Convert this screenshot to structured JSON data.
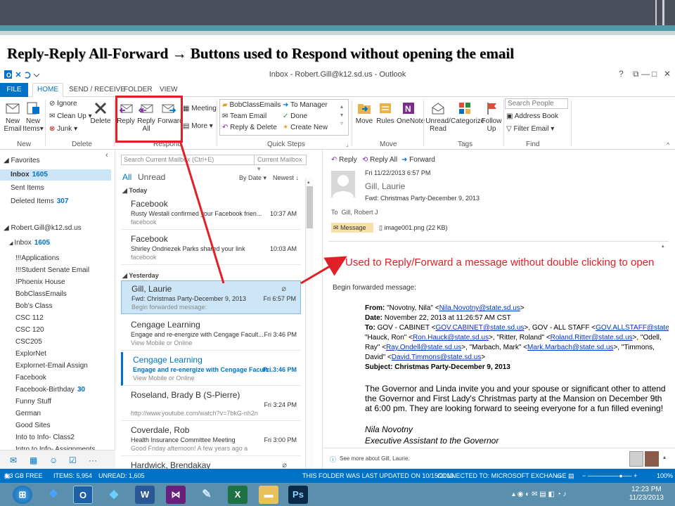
{
  "slide": {
    "title_part1": "Reply-Reply All-Forward",
    "title_arrow": "→",
    "title_part2": "Buttons used to Respond without opening the email"
  },
  "window": {
    "title": "Inbox - Robert.Gill@k12.sd.us - Outlook",
    "help_label": "?",
    "restore_label": "⧉",
    "minimize_label": "—",
    "maximize_label": "□",
    "close_label": "✕"
  },
  "tabs": [
    "FILE",
    "HOME",
    "SEND / RECEIVE",
    "FOLDER",
    "VIEW"
  ],
  "ribbon": {
    "new_group": {
      "label": "New",
      "new_email": [
        "New",
        "Email"
      ],
      "new_items": [
        "New",
        "Items"
      ]
    },
    "delete_group": {
      "label": "Delete",
      "ignore": "Ignore",
      "clean_up": "Clean Up",
      "junk": "Junk",
      "delete": "Delete"
    },
    "respond_group": {
      "label": "Respond",
      "reply": "Reply",
      "reply_all": [
        "Reply",
        "All"
      ],
      "forward": "Forward",
      "meeting": "Meeting",
      "more": "More"
    },
    "quick_steps": {
      "label": "Quick Steps",
      "items": [
        "BobClassEmails",
        "Team Email",
        "Reply & Delete",
        "To Manager",
        "Done",
        "Create New"
      ]
    },
    "move_group": {
      "label": "Move",
      "move": "Move",
      "rules": "Rules",
      "onenote": "OneNote"
    },
    "tags_group": {
      "label": "Tags",
      "unread_read": [
        "Unread/",
        "Read"
      ],
      "categorize": "Categorize",
      "follow_up": [
        "Follow",
        "Up"
      ]
    },
    "find_group": {
      "label": "Find",
      "search_people": "Search People",
      "address_book": "Address Book",
      "filter_email": "Filter Email"
    }
  },
  "folders": {
    "favorites_label": "Favorites",
    "favorites": [
      {
        "name": "Inbox",
        "count": "1605"
      },
      {
        "name": "Sent Items",
        "count": ""
      },
      {
        "name": "Deleted Items",
        "count": "307"
      }
    ],
    "account": "Robert.Gill@k12.sd.us",
    "inbox": {
      "name": "Inbox",
      "count": "1605"
    },
    "subfolders": [
      {
        "name": "!!!Applications",
        "count": ""
      },
      {
        "name": "!!!Student Senate Email",
        "count": ""
      },
      {
        "name": "!Phoenix House",
        "count": ""
      },
      {
        "name": "BobClassEmails",
        "count": ""
      },
      {
        "name": "Bob's Class",
        "count": ""
      },
      {
        "name": "CSC 112",
        "count": ""
      },
      {
        "name": "CSC 120",
        "count": ""
      },
      {
        "name": "CSC205",
        "count": ""
      },
      {
        "name": "ExplorNet",
        "count": ""
      },
      {
        "name": "Explornet-Email Assign",
        "count": ""
      },
      {
        "name": "Facebook",
        "count": ""
      },
      {
        "name": "Facebook-Birthday",
        "count": "30"
      },
      {
        "name": "Funny Stuff",
        "count": ""
      },
      {
        "name": "German",
        "count": ""
      },
      {
        "name": "Good Sites",
        "count": ""
      },
      {
        "name": "Into to Info- Class2",
        "count": ""
      },
      {
        "name": "Intro to Info- Assignments",
        "count": ""
      }
    ]
  },
  "message_list": {
    "search_placeholder": "Search Current Mailbox (Ctrl+E)",
    "search_scope": "Current Mailbox",
    "filter_all": "All",
    "filter_unread": "Unread",
    "sort_by": "By Date",
    "sort_order": "Newest",
    "group_today": "Today",
    "group_yesterday": "Yesterday",
    "messages": [
      {
        "from": "Facebook",
        "subject": "Rusty Westall confirmed your Facebook frien...",
        "preview": "facebook",
        "time": "10:37 AM"
      },
      {
        "from": "Facebook",
        "subject": "Shirley Ondriezek Parks shared your link",
        "preview": "facebook",
        "time": "10:03 AM"
      },
      {
        "from": "Gill, Laurie",
        "subject": "Fwd: Christmas Party-December 9, 2013",
        "preview": "Begin forwarded message:",
        "time": "Fri 6:57 PM"
      },
      {
        "from": "Cengage Learning",
        "subject": "Engage and re-energize with Cengage Facult...",
        "preview": "View Mobile or Online",
        "time": "Fri 3:46 PM"
      },
      {
        "from": "Cengage Learning",
        "subject": "Engage and re-energize with Cengage Facult...",
        "preview": "View Mobile or Online",
        "time": "Fri 3:46 PM"
      },
      {
        "from": "Roseland, Brady B (S-Pierre)",
        "subject": "",
        "preview": "http://www.youtube.com/watch?v=7bkG-nh2n",
        "time": "Fri 3:24 PM"
      },
      {
        "from": "Coverdale, Rob",
        "subject": "Health Insurance Committee Meeting",
        "preview": "Good Friday afternoon!  A few years ago a",
        "time": "Fri 3:00 PM"
      },
      {
        "from": "Hardwick, Brendakay",
        "subject": "",
        "preview": "",
        "time": ""
      }
    ]
  },
  "reading_pane": {
    "reply": "Reply",
    "reply_all": "Reply All",
    "forward": "Forward",
    "date": "Fri 11/22/2013 6:57 PM",
    "sender": "Gill, Laurie",
    "subject": "Fwd: Christmas Party-December 9, 2013",
    "to_label": "To",
    "to": "Gill, Robert J",
    "tab_message": "Message",
    "attachment": "image001.png (22 KB)",
    "begin_fwd": "Begin forwarded message:",
    "from_label": "From:",
    "from_value": "\"Novotny, Nila\" <",
    "from_link": "Nila.Novotny@state.sd.us",
    "date_label": "Date:",
    "date_value": "November 22, 2013 at 11:26:57 AM CST",
    "to_hdr_label": "To:",
    "to_line1_a": "GOV - CABINET <",
    "to_line1_link1": "GOV.CABINET@state.sd.us",
    "to_line1_b": ">, GOV - ALL STAFF <",
    "to_line1_link2": "GOV.ALLSTAFF@state.sd.us",
    "to_line1_c": ">,",
    "to_line2_a": "\"Hauck, Ron\" <",
    "to_line2_link1": "Ron.Hauck@state.sd.us",
    "to_line2_b": ">, \"Ritter, Roland\" <",
    "to_line2_link2": "Roland.Ritter@state.sd.us",
    "to_line2_c": ">, \"Odell,",
    "to_line3_a": "Ray\" <",
    "to_line3_link1": "Ray.Ondell@state.sd.us",
    "to_line3_b": ">, \"Marbach, Mark\" <",
    "to_line3_link2": "Mark.Marbach@state.sd.us",
    "to_line3_c": ">, \"Timmons,",
    "to_line4_a": "David\" <",
    "to_line4_link": "David.Timmons@state.sd.us",
    "to_line4_b": ">",
    "subject_label": "Subject:",
    "subject_value": "Christmas Party-December 9, 2013",
    "body_para": "The Governor and Linda invite you and your spouse or significant other to attend the Governor and First Lady's Christmas party at the Mansion on December 9th at 6:00 pm.  They are looking forward to seeing everyone for a fun filled evening!",
    "sig_name": "Nila Novotny",
    "sig_title": "Executive Assistant to the Governor",
    "see_more": "See more about Gill, Laurie."
  },
  "annotation": {
    "callout": "Used to Reply/Forward a message without double clicking to open",
    "color": "#e01f26"
  },
  "status_bar": {
    "free": "4.3 GB FREE",
    "items": "ITEMS: 5,954",
    "unread": "UNREAD: 1,605",
    "updated": "THIS FOLDER WAS LAST UPDATED ON 10/15/2013.",
    "connected": "CONNECTED TO: MICROSOFT EXCHANGE",
    "zoom": "100%"
  },
  "taskbar": {
    "time": "12:23 PM",
    "date": "11/23/2013",
    "outlook_label": "O",
    "word_label": "W",
    "excel_label": "X",
    "ps_label": "Ps"
  },
  "colors": {
    "accent": "#0072c6",
    "selection": "#cde6f7",
    "annotation": "#e01f26",
    "slide_banner": "#4b4f5b",
    "taskbar": "#5b8fae"
  }
}
